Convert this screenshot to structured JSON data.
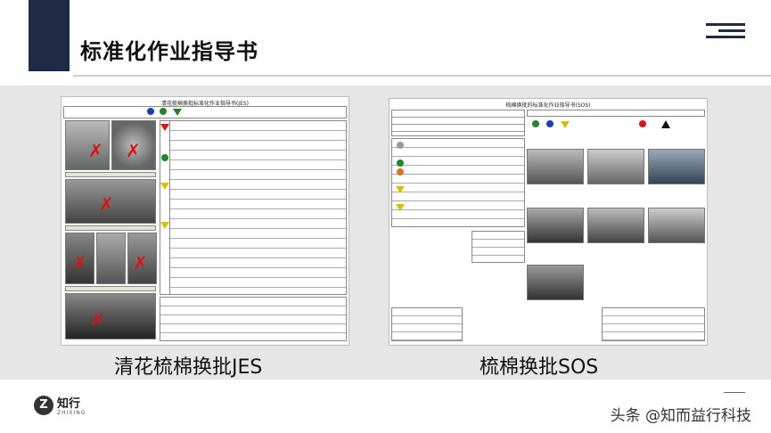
{
  "header": {
    "title": "标准化作业指导书"
  },
  "docs": {
    "left": {
      "title": "清花梳棉换批标准化作业指导书(JES)",
      "caption": "清花梳棉换批JES"
    },
    "right": {
      "title": "梳棉换批的标准化作业指导书(SOS)",
      "caption": "梳棉换批SOS"
    }
  },
  "footer": {
    "logo_letter": "Z",
    "logo_name": "知行",
    "logo_sub": "ZHIXING",
    "watermark": "头条 @知而益行科技"
  },
  "colors": {
    "navy": "#1f2a44",
    "band": "#e6e6e6",
    "mark_red": "#e01010"
  }
}
